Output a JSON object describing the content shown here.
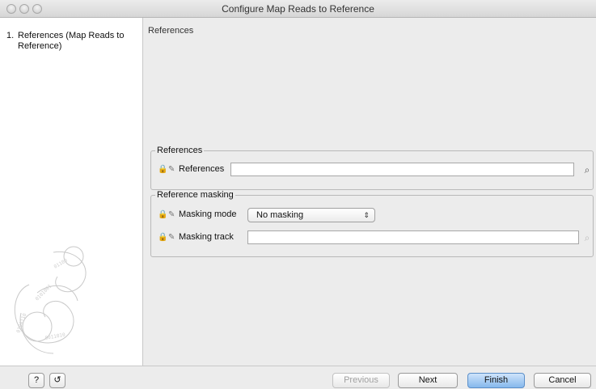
{
  "window": {
    "title": "Configure Map Reads to Reference"
  },
  "steps": [
    {
      "number": "1.",
      "label": "References (Map Reads to Reference)"
    }
  ],
  "panel": {
    "title": "References",
    "references_group": {
      "legend": "References",
      "references_label": "References",
      "references_value": ""
    },
    "masking_group": {
      "legend": "Reference masking",
      "mode_label": "Masking mode",
      "mode_value": "No masking",
      "track_label": "Masking track",
      "track_value": ""
    }
  },
  "footer": {
    "help_label": "?",
    "previous_label": "Previous",
    "next_label": "Next",
    "finish_label": "Finish",
    "cancel_label": "Cancel"
  },
  "icons": {
    "lock": "lock-icon",
    "edit": "pencil-icon",
    "browse": "browse-folder-icon",
    "reset": "reset-icon",
    "logo": "clc-swirl-logo"
  }
}
